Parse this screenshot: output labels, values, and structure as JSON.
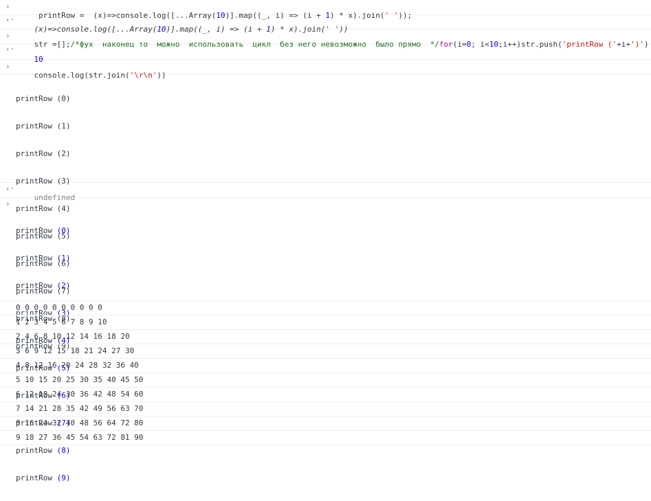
{
  "icons": {
    "input_prompt": "chevron-right-icon",
    "result_arrow": "result-arrow-icon"
  },
  "glyphs": {
    "prompt": "›",
    "result": "‹·"
  },
  "colors": {
    "number": "#1c00cf",
    "string": "#c41a16",
    "comment": "#236e25",
    "keyword": "#aa0d91",
    "undefined": "#80868b"
  },
  "entry1": {
    "a": " printRow =  (x)=>console.log([...Array(",
    "n1": "10",
    "b": ")].map((_, i) => (i + ",
    "n2": "1",
    "c": ") * x).join(",
    "s1": "' '",
    "d": "));"
  },
  "entry2": {
    "a": "(x)=>console.log([...Array(",
    "n1": "10",
    "b": ")].map((_, i) => (i + ",
    "n2": "1",
    "c": ") * x).join(",
    "s1": "' '",
    "d": "))"
  },
  "entry3": {
    "a": "str =[];",
    "comment": "/*фух  наконец то  можно  использовать  цикл  без него невозможно  было прямо  */",
    "kw": "for",
    "b": "(i=",
    "n1": "0",
    "c": "; i<",
    "n2": "10",
    "d": ";i++)str.push(",
    "s1": "'printRow ('",
    "e": "+i+",
    "s2": "')'",
    "f": ")"
  },
  "entry4": {
    "value": "10"
  },
  "entry5": {
    "a": "console.log(str.join(",
    "s1": "'\\r\\n'",
    "b": "))"
  },
  "entry6": {
    "lines": [
      "printRow (0)",
      "printRow (1)",
      "printRow (2)",
      "printRow (3)",
      "printRow (4)",
      "printRow (5)",
      "printRow (6)",
      "printRow (7)",
      "printRow (8)",
      "printRow (9)"
    ]
  },
  "entry7": {
    "value": "undefined"
  },
  "entry8": {
    "prefix": "printRow ",
    "args": [
      "(0)",
      "(1)",
      "(2)",
      "(3)",
      "(4)",
      "(5)",
      "(6)",
      "(7)",
      "(8)",
      "(9)"
    ]
  },
  "rows": [
    "0 0 0 0 0 0 0 0 0 0",
    "1 2 3 4 5 6 7 8 9 10",
    "2 4 6 8 10 12 14 16 18 20",
    "3 6 9 12 15 18 21 24 27 30",
    "4 8 12 16 20 24 28 32 36 40",
    "5 10 15 20 25 30 35 40 45 50",
    "6 12 18 24 30 36 42 48 54 60",
    "7 14 21 28 35 42 49 56 63 70",
    "8 16 24 32 40 48 56 64 72 80",
    "9 18 27 36 45 54 63 72 81 90"
  ]
}
